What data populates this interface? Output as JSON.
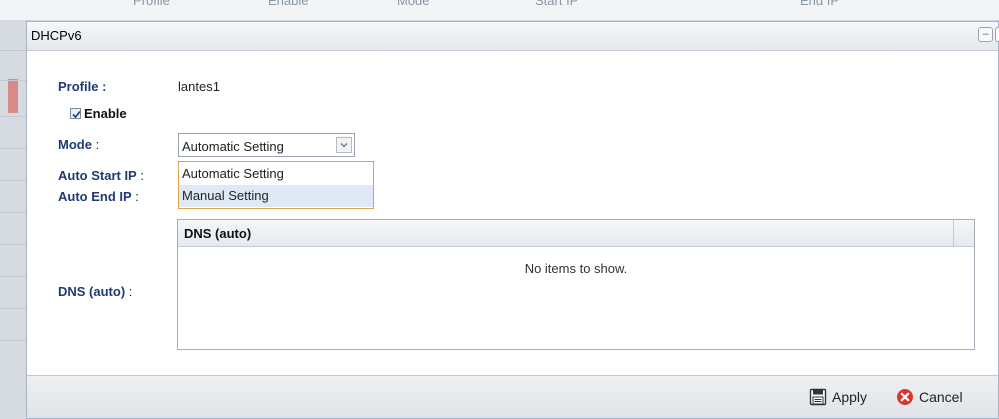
{
  "background": {
    "columns": [
      "Profile",
      "Enable",
      "Mode",
      "Start IP",
      "End IP"
    ]
  },
  "dialog": {
    "title": "DHCPv6",
    "minimize_symbol": "–",
    "close_symbol": "×"
  },
  "form": {
    "profile_label": "Profile :",
    "profile_value": "lantes1",
    "enable_label": "Enable",
    "enable_checked": true,
    "mode_label": "Mode",
    "mode_colon": " :",
    "mode_selected": "Automatic Setting",
    "mode_options": [
      "Automatic Setting",
      "Manual Setting"
    ],
    "mode_hovered_option": "Manual Setting",
    "auto_start_ip_label": "Auto Start IP",
    "auto_end_ip_label": "Auto End IP",
    "colon": " :",
    "dns_label": "DNS (auto)",
    "dns_colon": " :"
  },
  "dns_grid": {
    "column_header": "DNS (auto)",
    "empty_text": "No items to show."
  },
  "footer": {
    "apply_label": "Apply",
    "cancel_label": "Cancel"
  },
  "icons": {
    "apply": "save-icon",
    "cancel": "cancel-icon",
    "dropdown": "chevron-down-icon"
  }
}
